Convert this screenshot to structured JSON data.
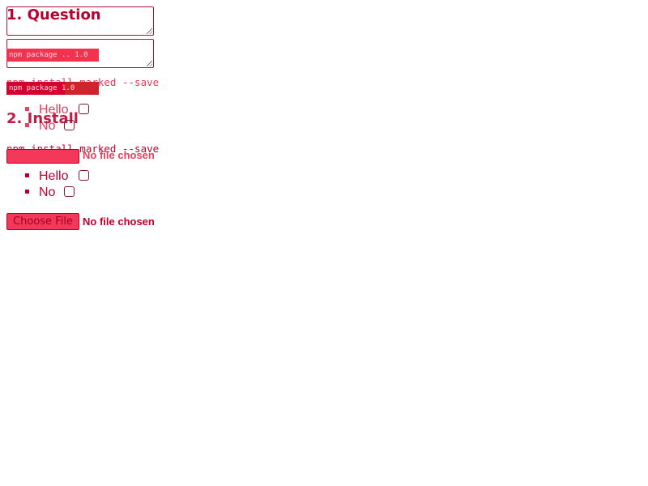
{
  "ghost": {
    "textarea_tag_text": "npm package .. 1.0",
    "code_line": "npm install marked --save",
    "tag_text": "npm package 1.0",
    "options": [
      {
        "label": "Hello"
      },
      {
        "label": "No"
      }
    ],
    "file": {
      "note": "No file chosen"
    }
  },
  "sections": [
    {
      "heading": "1. Question"
    },
    {
      "heading": "2. Install",
      "code_line": "npm install marked --save",
      "options": [
        {
          "label": "Hello"
        },
        {
          "label": "No"
        }
      ],
      "file": {
        "button_label": "Choose File",
        "note": "No file chosen"
      }
    }
  ],
  "colors": {
    "accent": "#b8002f",
    "button_fill": "#f4385a",
    "tag_pink": "#f2324f",
    "tag_red": "#c8001f"
  }
}
